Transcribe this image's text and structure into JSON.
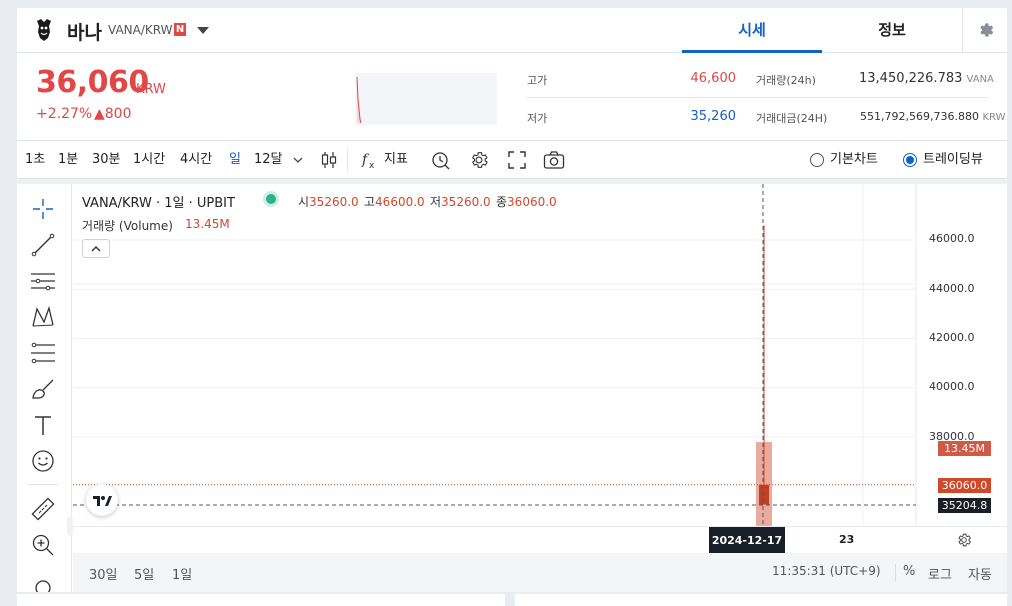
{
  "header": {
    "coin_name": "바나",
    "coin_symbol": "VANA/KRW",
    "badge": "N",
    "tabs": [
      {
        "label": "시세",
        "active": true
      },
      {
        "label": "정보",
        "active": false
      }
    ]
  },
  "summary": {
    "price": "36,060",
    "currency": "KRW",
    "change_percent": "+2.27%",
    "change_amount": "▲800",
    "high_label": "고가",
    "high_value": "46,600",
    "low_label": "저가",
    "low_value": "35,260",
    "volume_label": "거래량(24h)",
    "volume_value": "13,450,226.783",
    "volume_unit": "VANA",
    "amount_label": "거래대금(24H)",
    "amount_value": "551,792,569,736.880",
    "amount_unit": "KRW"
  },
  "toolbar": {
    "intervals": [
      {
        "label": "1초",
        "active": false
      },
      {
        "label": "1분",
        "active": false
      },
      {
        "label": "30분",
        "active": false
      },
      {
        "label": "1시간",
        "active": false
      },
      {
        "label": "4시간",
        "active": false
      },
      {
        "label": "일",
        "active": true
      },
      {
        "label": "12달",
        "active": false
      }
    ],
    "indicator_label": "지표",
    "chart_basic_label": "기본차트",
    "chart_trading_label": "트레이딩뷰",
    "selected_view": "트레이딩뷰"
  },
  "chart": {
    "legend_title": "VANA/KRW · 1일 · UPBIT",
    "ohlc": [
      {
        "k": "시",
        "v": "35260.0"
      },
      {
        "k": "고",
        "v": "46600.0"
      },
      {
        "k": "저",
        "v": "35260.0"
      },
      {
        "k": "종",
        "v": "36060.0"
      }
    ],
    "volume_label": "거래량 (Volume)",
    "volume_value": "13.45M",
    "y_ticks": [
      "46000.0",
      "44000.0",
      "42000.0",
      "40000.0",
      "38000.0"
    ],
    "volume_tag": "13.45M",
    "price_tag": "36060.0",
    "crosshair_tag": "35204.8",
    "x_date_label": "2024-12-17",
    "x_tick": "23"
  },
  "chart_data": {
    "type": "candlestick",
    "x": [
      "2024-12-17"
    ],
    "open": [
      35260.0
    ],
    "high": [
      46600.0
    ],
    "low": [
      35260.0
    ],
    "close": [
      36060.0
    ],
    "volume": [
      13.45
    ],
    "ylim": [
      34500,
      47000
    ],
    "grid": true
  },
  "bottom": {
    "ranges": [
      "30일",
      "5일",
      "1일"
    ],
    "clock": "11:35:31 (UTC+9)",
    "percent": "%",
    "log": "로그",
    "auto": "자동"
  },
  "colors": {
    "up": "#e04848",
    "down": "#1261c4",
    "candle": "#d0492b",
    "accent": "#1261c4"
  }
}
